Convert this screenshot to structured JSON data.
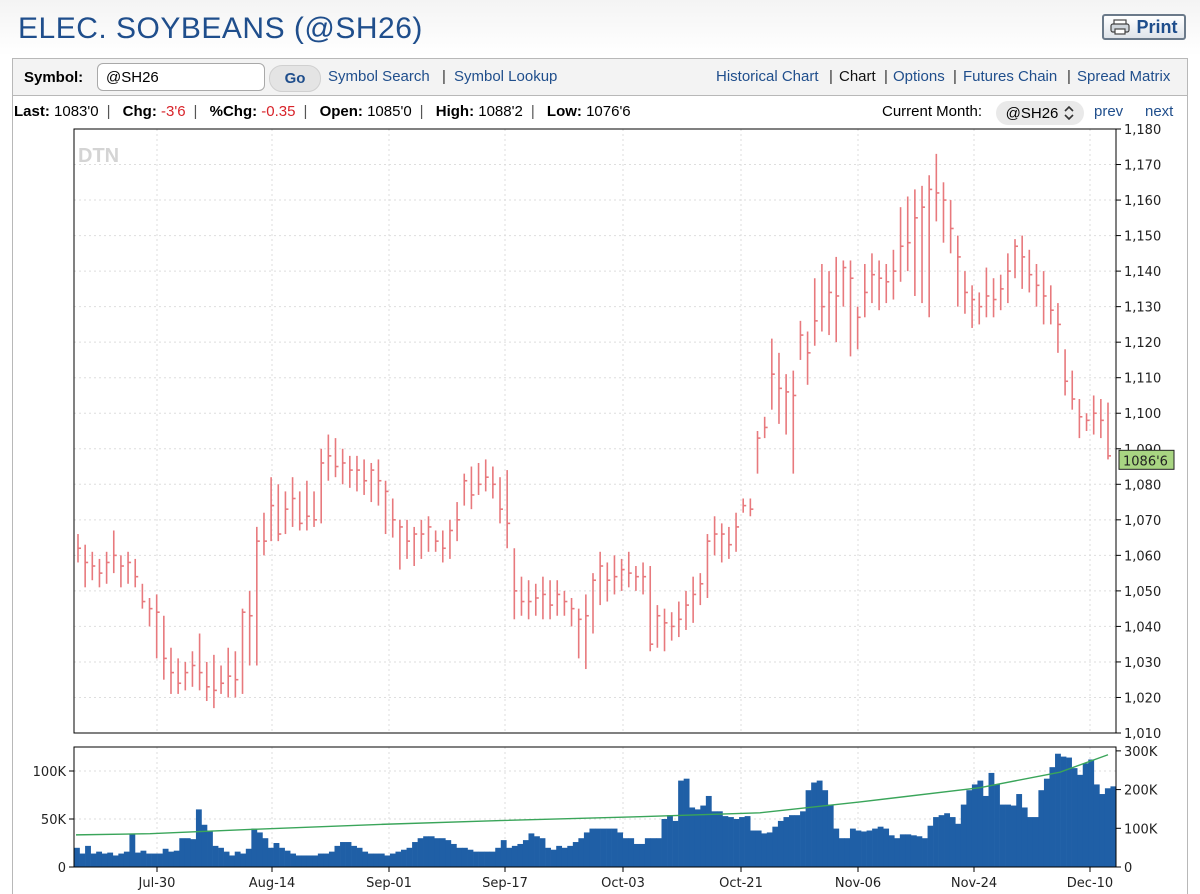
{
  "title": "ELEC. SOYBEANS  (@SH26)",
  "print_label": "Print",
  "toolbar": {
    "symbol_label": "Symbol:",
    "symbol_value": "@SH26",
    "go_label": "Go",
    "symbol_search": "Symbol Search",
    "symbol_lookup": "Symbol Lookup",
    "historical_chart": "Historical Chart",
    "chart": "Chart",
    "options": "Options",
    "futures_chain": "Futures Chain",
    "spread_matrix": "Spread Matrix"
  },
  "quote": {
    "last_label": "Last:",
    "last": "1083'0",
    "chg_label": "Chg:",
    "chg": "-3'6",
    "pctchg_label": "%Chg:",
    "pctchg": "-0.35",
    "open_label": "Open:",
    "open": "1085'0",
    "high_label": "High:",
    "high": "1088'2",
    "low_label": "Low:",
    "low": "1076'6"
  },
  "current_month_label": "Current Month:",
  "current_month": "@SH26",
  "prev_label": "prev",
  "next_label": "next",
  "watermark": "DTN",
  "colors": {
    "bar": "#e8797d",
    "volume": "#1f5fa6",
    "oi_line": "#3aa55a",
    "last_tag": "#a8d582",
    "link": "#1f4e8c"
  },
  "chart_data": [
    {
      "type": "ohlc",
      "x_labels": [
        "Jul-30",
        "Aug-14",
        "Sep-01",
        "Sep-17",
        "Oct-03",
        "Oct-21",
        "Nov-06",
        "Nov-24",
        "Dec-10"
      ],
      "y_ticks": [
        "1,010",
        "1,020",
        "1,030",
        "1,040",
        "1,050",
        "1,060",
        "1,070",
        "1,080",
        "1,090",
        "1,100",
        "1,110",
        "1,120",
        "1,130",
        "1,140",
        "1,150",
        "1,160",
        "1,170",
        "1,180"
      ],
      "ylim": [
        1010,
        1180
      ],
      "last_tag": "1086'6",
      "last_value": 1086.75,
      "grid": true,
      "bars": [
        {
          "h": 1066,
          "l": 1058,
          "c": 1062
        },
        {
          "h": 1063,
          "l": 1051,
          "c": 1058
        },
        {
          "h": 1061,
          "l": 1053,
          "c": 1057
        },
        {
          "h": 1059,
          "l": 1051,
          "c": 1055
        },
        {
          "h": 1061,
          "l": 1052,
          "c": 1058
        },
        {
          "h": 1067,
          "l": 1055,
          "c": 1060
        },
        {
          "h": 1060,
          "l": 1051,
          "c": 1057
        },
        {
          "h": 1061,
          "l": 1052,
          "c": 1058
        },
        {
          "h": 1059,
          "l": 1051,
          "c": 1054
        },
        {
          "h": 1052,
          "l": 1045,
          "c": 1047
        },
        {
          "h": 1048,
          "l": 1040,
          "c": 1045
        },
        {
          "h": 1049,
          "l": 1031,
          "c": 1044
        },
        {
          "h": 1043,
          "l": 1025,
          "c": 1031
        },
        {
          "h": 1034,
          "l": 1021,
          "c": 1027
        },
        {
          "h": 1031,
          "l": 1021,
          "c": 1024
        },
        {
          "h": 1030,
          "l": 1022,
          "c": 1027
        },
        {
          "h": 1033,
          "l": 1023,
          "c": 1029
        },
        {
          "h": 1038,
          "l": 1022,
          "c": 1027
        },
        {
          "h": 1030,
          "l": 1019,
          "c": 1023
        },
        {
          "h": 1032,
          "l": 1017,
          "c": 1022
        },
        {
          "h": 1029,
          "l": 1021,
          "c": 1024
        },
        {
          "h": 1034,
          "l": 1020,
          "c": 1026
        },
        {
          "h": 1033,
          "l": 1020,
          "c": 1025
        },
        {
          "h": 1045,
          "l": 1021,
          "c": 1044
        },
        {
          "h": 1050,
          "l": 1029,
          "c": 1043
        },
        {
          "h": 1068,
          "l": 1029,
          "c": 1064
        },
        {
          "h": 1072,
          "l": 1060,
          "c": 1064
        },
        {
          "h": 1082,
          "l": 1064,
          "c": 1074
        },
        {
          "h": 1080,
          "l": 1064,
          "c": 1066
        },
        {
          "h": 1078,
          "l": 1066,
          "c": 1073
        },
        {
          "h": 1082,
          "l": 1068,
          "c": 1076
        },
        {
          "h": 1078,
          "l": 1067,
          "c": 1069
        },
        {
          "h": 1081,
          "l": 1067,
          "c": 1071
        },
        {
          "h": 1078,
          "l": 1068,
          "c": 1070
        },
        {
          "h": 1090,
          "l": 1069,
          "c": 1086
        },
        {
          "h": 1094,
          "l": 1081,
          "c": 1088
        },
        {
          "h": 1093,
          "l": 1082,
          "c": 1085
        },
        {
          "h": 1090,
          "l": 1080,
          "c": 1086
        },
        {
          "h": 1088,
          "l": 1079,
          "c": 1084
        },
        {
          "h": 1088,
          "l": 1078,
          "c": 1084
        },
        {
          "h": 1087,
          "l": 1077,
          "c": 1081
        },
        {
          "h": 1086,
          "l": 1075,
          "c": 1084
        },
        {
          "h": 1087,
          "l": 1074,
          "c": 1081
        },
        {
          "h": 1081,
          "l": 1066,
          "c": 1078
        },
        {
          "h": 1076,
          "l": 1065,
          "c": 1070
        },
        {
          "h": 1070,
          "l": 1056,
          "c": 1068
        },
        {
          "h": 1070,
          "l": 1059,
          "c": 1064
        },
        {
          "h": 1068,
          "l": 1057,
          "c": 1066
        },
        {
          "h": 1070,
          "l": 1059,
          "c": 1066
        },
        {
          "h": 1071,
          "l": 1061,
          "c": 1068
        },
        {
          "h": 1067,
          "l": 1061,
          "c": 1064
        },
        {
          "h": 1067,
          "l": 1058,
          "c": 1062
        },
        {
          "h": 1070,
          "l": 1059,
          "c": 1067
        },
        {
          "h": 1075,
          "l": 1064,
          "c": 1070
        },
        {
          "h": 1083,
          "l": 1074,
          "c": 1081
        },
        {
          "h": 1085,
          "l": 1073,
          "c": 1077
        },
        {
          "h": 1086,
          "l": 1077,
          "c": 1080
        },
        {
          "h": 1087,
          "l": 1078,
          "c": 1082
        },
        {
          "h": 1085,
          "l": 1076,
          "c": 1080
        },
        {
          "h": 1082,
          "l": 1069,
          "c": 1073
        },
        {
          "h": 1084,
          "l": 1062,
          "c": 1069
        },
        {
          "h": 1062,
          "l": 1042,
          "c": 1050
        },
        {
          "h": 1054,
          "l": 1043,
          "c": 1047
        },
        {
          "h": 1053,
          "l": 1042,
          "c": 1047
        },
        {
          "h": 1052,
          "l": 1043,
          "c": 1048
        },
        {
          "h": 1054,
          "l": 1042,
          "c": 1049
        },
        {
          "h": 1053,
          "l": 1042,
          "c": 1046
        },
        {
          "h": 1053,
          "l": 1043,
          "c": 1049
        },
        {
          "h": 1050,
          "l": 1043,
          "c": 1047
        },
        {
          "h": 1048,
          "l": 1040,
          "c": 1045
        },
        {
          "h": 1045,
          "l": 1031,
          "c": 1042
        },
        {
          "h": 1049,
          "l": 1028,
          "c": 1043
        },
        {
          "h": 1055,
          "l": 1038,
          "c": 1053
        },
        {
          "h": 1061,
          "l": 1046,
          "c": 1057
        },
        {
          "h": 1058,
          "l": 1047,
          "c": 1053
        },
        {
          "h": 1060,
          "l": 1049,
          "c": 1054
        },
        {
          "h": 1059,
          "l": 1050,
          "c": 1056
        },
        {
          "h": 1061,
          "l": 1051,
          "c": 1055
        },
        {
          "h": 1057,
          "l": 1050,
          "c": 1054
        },
        {
          "h": 1058,
          "l": 1049,
          "c": 1054
        },
        {
          "h": 1057,
          "l": 1033,
          "c": 1035
        },
        {
          "h": 1046,
          "l": 1034,
          "c": 1043
        },
        {
          "h": 1045,
          "l": 1033,
          "c": 1041
        },
        {
          "h": 1044,
          "l": 1036,
          "c": 1040
        },
        {
          "h": 1047,
          "l": 1037,
          "c": 1042
        },
        {
          "h": 1050,
          "l": 1039,
          "c": 1046
        },
        {
          "h": 1054,
          "l": 1041,
          "c": 1049
        },
        {
          "h": 1055,
          "l": 1046,
          "c": 1052
        },
        {
          "h": 1066,
          "l": 1048,
          "c": 1064
        },
        {
          "h": 1071,
          "l": 1060,
          "c": 1066
        },
        {
          "h": 1069,
          "l": 1058,
          "c": 1066
        },
        {
          "h": 1068,
          "l": 1059,
          "c": 1063
        },
        {
          "h": 1072,
          "l": 1061,
          "c": 1068
        },
        {
          "h": 1076,
          "l": 1072,
          "c": 1074
        },
        {
          "h": 1076,
          "l": 1071,
          "c": 1073
        },
        {
          "h": 1095,
          "l": 1083,
          "c": 1093
        },
        {
          "h": 1099,
          "l": 1093,
          "c": 1096
        },
        {
          "h": 1121,
          "l": 1101,
          "c": 1111
        },
        {
          "h": 1117,
          "l": 1097,
          "c": 1107
        },
        {
          "h": 1111,
          "l": 1094,
          "c": 1106
        },
        {
          "h": 1112,
          "l": 1083,
          "c": 1105
        },
        {
          "h": 1126,
          "l": 1115,
          "c": 1122
        },
        {
          "h": 1123,
          "l": 1108,
          "c": 1117
        },
        {
          "h": 1138,
          "l": 1119,
          "c": 1126
        },
        {
          "h": 1142,
          "l": 1123,
          "c": 1130
        },
        {
          "h": 1140,
          "l": 1122,
          "c": 1134
        },
        {
          "h": 1144,
          "l": 1120,
          "c": 1133
        },
        {
          "h": 1143,
          "l": 1130,
          "c": 1141
        },
        {
          "h": 1143,
          "l": 1116,
          "c": 1138
        },
        {
          "h": 1130,
          "l": 1118,
          "c": 1127
        },
        {
          "h": 1142,
          "l": 1127,
          "c": 1134
        },
        {
          "h": 1145,
          "l": 1131,
          "c": 1139
        },
        {
          "h": 1143,
          "l": 1129,
          "c": 1138
        },
        {
          "h": 1142,
          "l": 1131,
          "c": 1137
        },
        {
          "h": 1146,
          "l": 1132,
          "c": 1140
        },
        {
          "h": 1158,
          "l": 1137,
          "c": 1147
        },
        {
          "h": 1161,
          "l": 1140,
          "c": 1148
        },
        {
          "h": 1163,
          "l": 1133,
          "c": 1155
        },
        {
          "h": 1164,
          "l": 1131,
          "c": 1158
        },
        {
          "h": 1167,
          "l": 1127,
          "c": 1163
        },
        {
          "h": 1173,
          "l": 1154,
          "c": 1162
        },
        {
          "h": 1165,
          "l": 1148,
          "c": 1160
        },
        {
          "h": 1160,
          "l": 1145,
          "c": 1152
        },
        {
          "h": 1150,
          "l": 1130,
          "c": 1144
        },
        {
          "h": 1140,
          "l": 1128,
          "c": 1134
        },
        {
          "h": 1136,
          "l": 1124,
          "c": 1132
        },
        {
          "h": 1134,
          "l": 1125,
          "c": 1130
        },
        {
          "h": 1141,
          "l": 1127,
          "c": 1133
        },
        {
          "h": 1138,
          "l": 1127,
          "c": 1132
        },
        {
          "h": 1139,
          "l": 1129,
          "c": 1135
        },
        {
          "h": 1145,
          "l": 1131,
          "c": 1140
        },
        {
          "h": 1149,
          "l": 1138,
          "c": 1147
        },
        {
          "h": 1150,
          "l": 1135,
          "c": 1144
        },
        {
          "h": 1146,
          "l": 1134,
          "c": 1139
        },
        {
          "h": 1142,
          "l": 1130,
          "c": 1136
        },
        {
          "h": 1140,
          "l": 1125,
          "c": 1133
        },
        {
          "h": 1136,
          "l": 1125,
          "c": 1129
        },
        {
          "h": 1131,
          "l": 1117,
          "c": 1125
        },
        {
          "h": 1118,
          "l": 1105,
          "c": 1109
        },
        {
          "h": 1112,
          "l": 1101,
          "c": 1104
        },
        {
          "h": 1104,
          "l": 1093,
          "c": 1099
        },
        {
          "h": 1100,
          "l": 1095,
          "c": 1098
        },
        {
          "h": 1105,
          "l": 1094,
          "c": 1100
        },
        {
          "h": 1104,
          "l": 1093,
          "c": 1098
        },
        {
          "h": 1103,
          "l": 1087,
          "c": 1088
        }
      ]
    },
    {
      "type": "bar",
      "y_ticks_left": [
        "0",
        "50K",
        "100K"
      ],
      "y_ticks_right": [
        "0",
        "100K",
        "200K",
        "300K"
      ],
      "ylim_left": [
        0,
        125000
      ],
      "ylim_right": [
        0,
        310000
      ],
      "series": [
        {
          "values": [
            20,
            14,
            22,
            14,
            16,
            14,
            15,
            12,
            14,
            16,
            34,
            15,
            17,
            14,
            14,
            14,
            19,
            16,
            17,
            30,
            30,
            29,
            60,
            44,
            38,
            22,
            20,
            16,
            12,
            16,
            14,
            19,
            40,
            36,
            30,
            20,
            25,
            20,
            17,
            14,
            12,
            12,
            12,
            12,
            14,
            14,
            16,
            22,
            26,
            26,
            22,
            20,
            16,
            14,
            14,
            14,
            12,
            14,
            16,
            18,
            20,
            26,
            30,
            32,
            32,
            30,
            30,
            28,
            24,
            20,
            20,
            18,
            16,
            16,
            16,
            16,
            20,
            28,
            20,
            22,
            24,
            28,
            35,
            32,
            30,
            20,
            18,
            22,
            20,
            22,
            26,
            30,
            36,
            40,
            40,
            40,
            40,
            40,
            36,
            30,
            30,
            24,
            24,
            30,
            30,
            30,
            50,
            54,
            48,
            90,
            92,
            62,
            60,
            64,
            74,
            58,
            58,
            53,
            52,
            50,
            52,
            53,
            38,
            38,
            35,
            36,
            42,
            48,
            52,
            54,
            54,
            58,
            80,
            88,
            90,
            80,
            65,
            40,
            30,
            30,
            40,
            38,
            37,
            38,
            40,
            42,
            40,
            33,
            30,
            34,
            34,
            33,
            32,
            30,
            43,
            52,
            54,
            56,
            52,
            45,
            65,
            80,
            86,
            90,
            74,
            98,
            86,
            65,
            65,
            64,
            76,
            62,
            52,
            52,
            80,
            92,
            104,
            118,
            115,
            114,
            103,
            96,
            108,
            112,
            86,
            76,
            82,
            84
          ]
        }
      ]
    }
  ]
}
